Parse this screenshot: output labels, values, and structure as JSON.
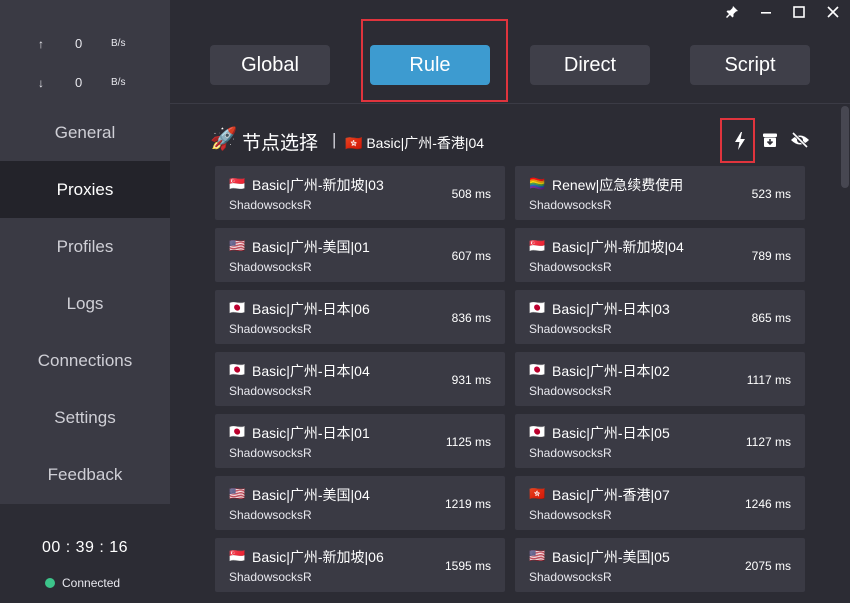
{
  "window": {
    "controls": {
      "pin": "📌",
      "minimize": "—",
      "maximize": "☐",
      "close": "✕"
    }
  },
  "traffic": {
    "up_arrow": "↑",
    "up_value": "0",
    "up_unit": "B/s",
    "down_arrow": "↓",
    "down_value": "0",
    "down_unit": "B/s"
  },
  "nav": [
    {
      "label": "General"
    },
    {
      "label": "Proxies"
    },
    {
      "label": "Profiles"
    },
    {
      "label": "Logs"
    },
    {
      "label": "Connections"
    },
    {
      "label": "Settings"
    },
    {
      "label": "Feedback"
    }
  ],
  "active_nav": "Proxies",
  "footer": {
    "clock": "00 : 39 : 16",
    "status": "Connected",
    "status_color": "#3cc48a"
  },
  "modes": [
    {
      "label": "Global"
    },
    {
      "label": "Rule"
    },
    {
      "label": "Direct"
    },
    {
      "label": "Script"
    }
  ],
  "active_mode": "Rule",
  "group": {
    "icon": "🚀",
    "name": "节点选择",
    "separator": "|",
    "current_flag": "🇭🇰",
    "current": "Basic|广州-香港|04"
  },
  "toolbar_icons": {
    "latency_test": "bolt-icon",
    "collapse": "archive-icon",
    "hide": "eye-slash-icon"
  },
  "proxies": [
    {
      "flag": "🇸🇬",
      "name": "Basic|广州-新加坡|03",
      "type": "ShadowsocksR",
      "latency": "508 ms"
    },
    {
      "flag": "🏳️‍🌈",
      "name": "Renew|应急续费使用",
      "type": "ShadowsocksR",
      "latency": "523 ms"
    },
    {
      "flag": "🇺🇸",
      "name": "Basic|广州-美国|01",
      "type": "ShadowsocksR",
      "latency": "607 ms"
    },
    {
      "flag": "🇸🇬",
      "name": "Basic|广州-新加坡|04",
      "type": "ShadowsocksR",
      "latency": "789 ms"
    },
    {
      "flag": "🇯🇵",
      "name": "Basic|广州-日本|06",
      "type": "ShadowsocksR",
      "latency": "836 ms"
    },
    {
      "flag": "🇯🇵",
      "name": "Basic|广州-日本|03",
      "type": "ShadowsocksR",
      "latency": "865 ms"
    },
    {
      "flag": "🇯🇵",
      "name": "Basic|广州-日本|04",
      "type": "ShadowsocksR",
      "latency": "931 ms"
    },
    {
      "flag": "🇯🇵",
      "name": "Basic|广州-日本|02",
      "type": "ShadowsocksR",
      "latency": "1117 ms"
    },
    {
      "flag": "🇯🇵",
      "name": "Basic|广州-日本|01",
      "type": "ShadowsocksR",
      "latency": "1125 ms"
    },
    {
      "flag": "🇯🇵",
      "name": "Basic|广州-日本|05",
      "type": "ShadowsocksR",
      "latency": "1127 ms"
    },
    {
      "flag": "🇺🇸",
      "name": "Basic|广州-美国|04",
      "type": "ShadowsocksR",
      "latency": "1219 ms"
    },
    {
      "flag": "🇭🇰",
      "name": "Basic|广州-香港|07",
      "type": "ShadowsocksR",
      "latency": "1246 ms"
    },
    {
      "flag": "🇸🇬",
      "name": "Basic|广州-新加坡|06",
      "type": "ShadowsocksR",
      "latency": "1595 ms"
    },
    {
      "flag": "🇺🇸",
      "name": "Basic|广州-美国|05",
      "type": "ShadowsocksR",
      "latency": "2075 ms"
    }
  ]
}
